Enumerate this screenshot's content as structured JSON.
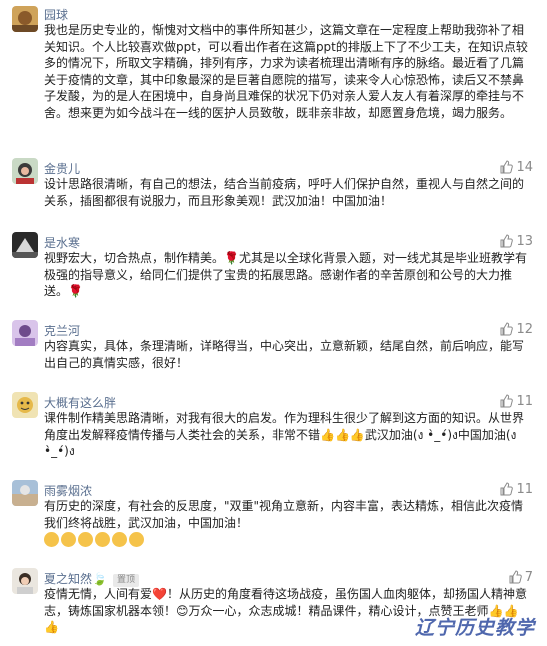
{
  "comments": [
    {
      "name": "园球",
      "badge": "",
      "likes": "",
      "text": "我也是历史专业的，惭愧对文档中的事件所知甚少，这篇文章在一定程度上帮助我弥补了相关知识。个人比较喜欢做ppt，可以看出作者在这篇ppt的排版上下了不少工夫，在知识点较多的情况下，所取文字精确，排列有序，力求为读者梳理出清晰有序的脉络。最近看了几篇关于疫情的文章，其中印象最深的是巨著自愿院的描写，读来令人心惊恐怖，读后又不禁鼻子发酸，为的是人在困境中，自身尚且难保的状况下仍对亲人爱人友人有着深厚的牵挂与不舍。想来更为如今战斗在一线的医护人员致敬，既非亲非故，却愿置身危境，竭力服务。"
    },
    {
      "name": "金贵儿",
      "badge": "",
      "likes": "14",
      "text": "设计思路很清晰，有自己的想法，结合当前疫病，呼吁人们保护自然，重视人与自然之间的关系，插图都很有说服力，而且形象美观！武汉加油！中国加油！"
    },
    {
      "name": "是水寒",
      "badge": "",
      "likes": "13",
      "text": "视野宏大，切合热点，制作精美。🌹尤其是以全球化背景入题，对一线尤其是毕业班教学有极强的指导意义，给同仁们提供了宝贵的拓展思路。感谢作者的辛苦原创和公号的大力推送。🌹"
    },
    {
      "name": "克兰河",
      "badge": "",
      "likes": "12",
      "text": "内容真实，具体，条理清晰，详略得当，中心突出，立意新颖，结尾自然，前后响应，能写出自己的真情实感，很好！"
    },
    {
      "name": "大概有这么胖",
      "badge": "",
      "likes": "11",
      "text": "课件制作精美思路清晰，对我有很大的启发。作为理科生很少了解到这方面的知识。从世界角度出发解释疫情传播与人类社会的关系，非常不错👍👍👍武汉加油(ง •̀_•́)ง中国加油(ง •̀_•́)ง"
    },
    {
      "name": "雨雾烟浓",
      "badge": "",
      "likes": "11",
      "text": "有历史的深度，有社会的反思度，\"双重\"视角立意新，内容丰富，表达精炼，相信此次疫情我们终将战胜，武汉加油，中国加油！"
    },
    {
      "name": "夏之知然🍃",
      "badge": "置顶",
      "likes": "7",
      "text": "疫情无情，人间有爱❤️！从历史的角度看待这场战疫，虽伤国人血肉躯体，却扬国人精神意志，铸炼国家机器本领！😊万众一心，众志成城！精品课件，精心设计，点赞王老师👍👍👍"
    }
  ],
  "badge_top": "置顶",
  "watermark": "辽宁历史教学"
}
